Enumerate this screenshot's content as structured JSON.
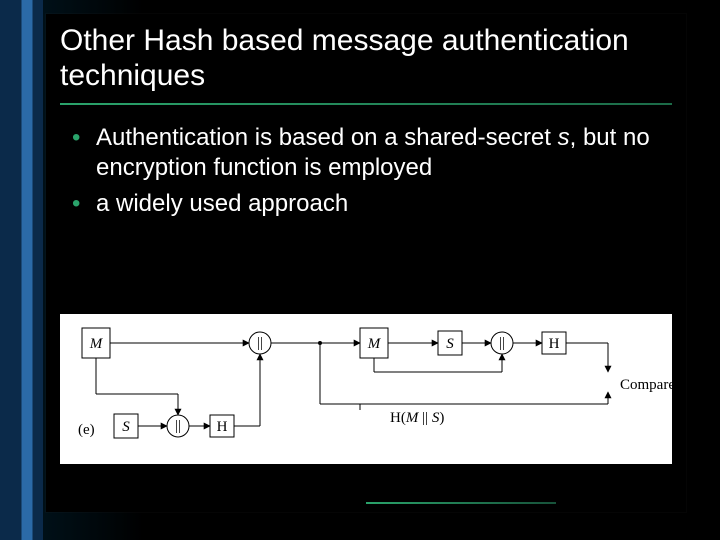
{
  "title": "Other Hash based message authentication techniques",
  "bullets": [
    {
      "pre": "Authentication is based on a shared-secret ",
      "em": "s",
      "post": ", but no encryption function is employed"
    },
    {
      "pre": "a widely used approach",
      "em": "",
      "post": ""
    }
  ],
  "diagram": {
    "row_label": "(e)",
    "M": "M",
    "S": "S",
    "concat": "||",
    "H": "H",
    "hash_label": "H(M || S)",
    "compare": "Compare"
  }
}
